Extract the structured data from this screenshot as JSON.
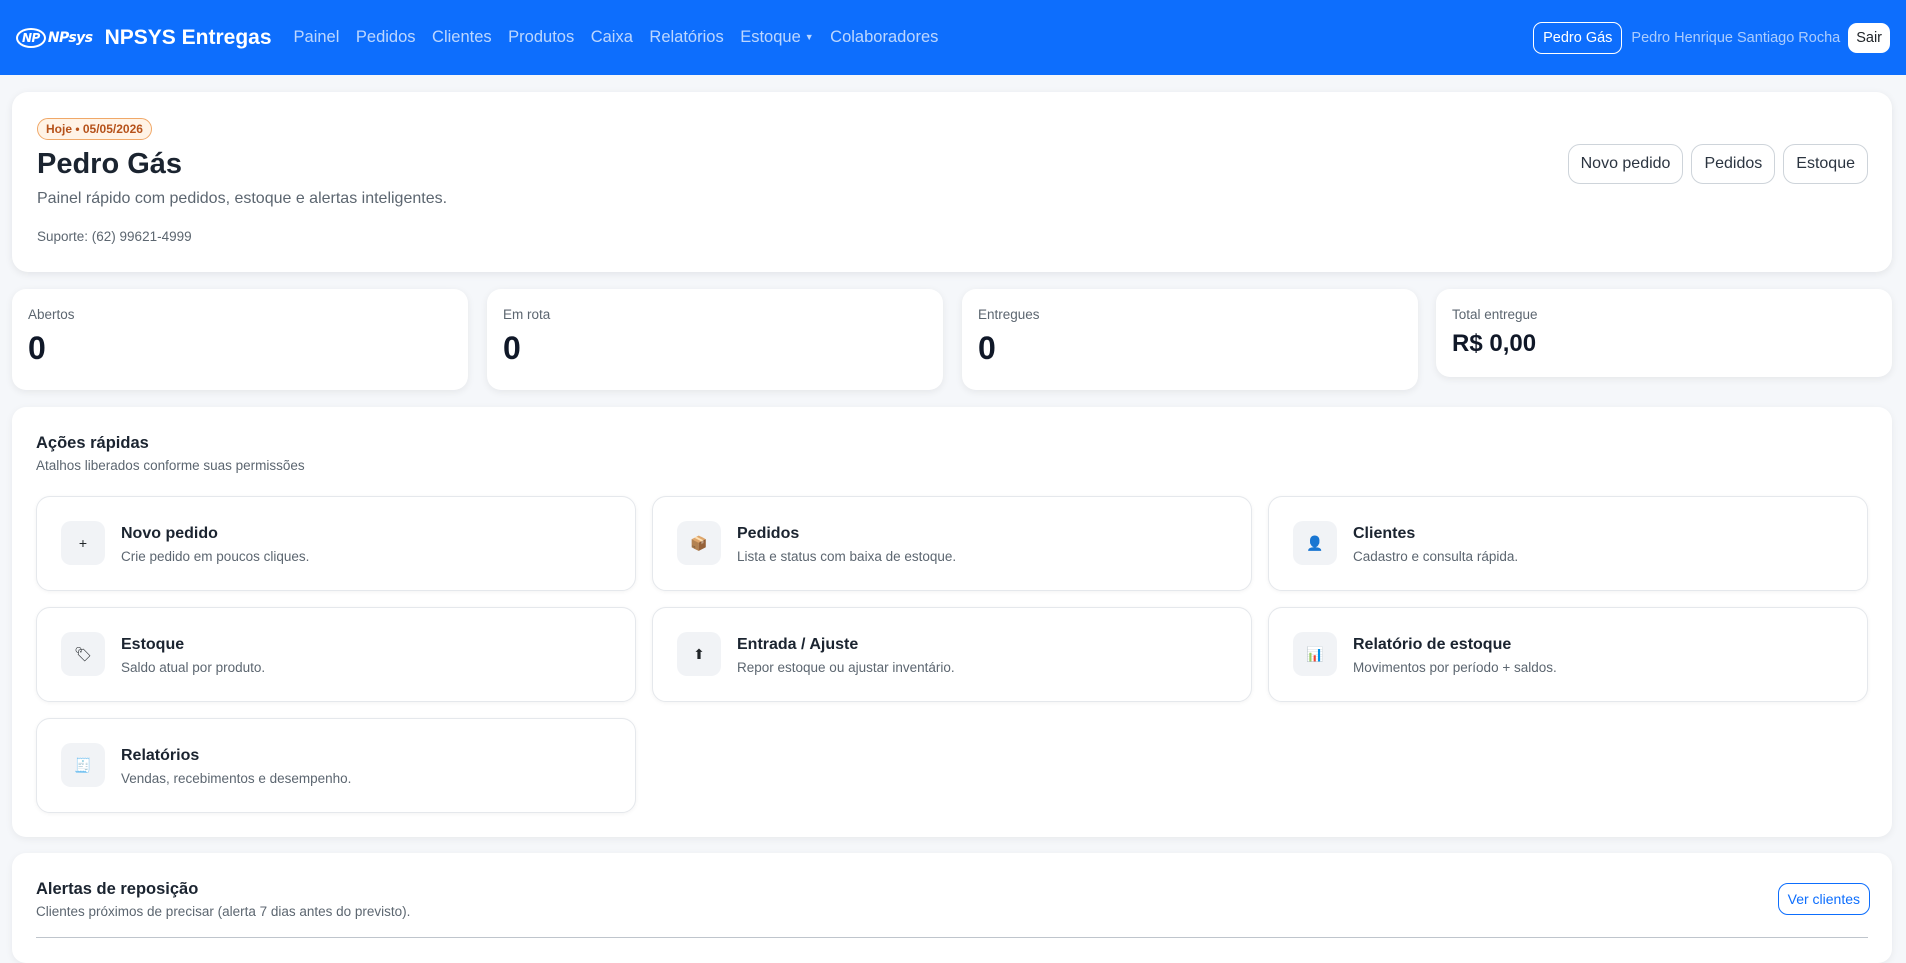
{
  "navbar": {
    "logo_text": "NPsys",
    "logo_mark": "NP",
    "brand": "NPSYS Entregas",
    "links": [
      "Painel",
      "Pedidos",
      "Clientes",
      "Produtos",
      "Caixa",
      "Relatórios",
      "Estoque",
      "Colaboradores"
    ],
    "company": "Pedro Gás",
    "user": "Pedro Henrique Santiago Rocha",
    "logout": "Sair"
  },
  "hero": {
    "date_badge": "Hoje • 05/05/2026",
    "title": "Pedro Gás",
    "subtitle": "Painel rápido com pedidos, estoque e alertas inteligentes.",
    "support": "Suporte: (62) 99621-4999",
    "actions": [
      "Novo pedido",
      "Pedidos",
      "Estoque"
    ]
  },
  "stats": [
    {
      "label": "Abertos",
      "value": "0"
    },
    {
      "label": "Em rota",
      "value": "0"
    },
    {
      "label": "Entregues",
      "value": "0"
    },
    {
      "label": "Total entregue",
      "value": "R$ 0,00"
    }
  ],
  "quick_actions": {
    "title": "Ações rápidas",
    "subtitle": "Atalhos liberados conforme suas permissões",
    "tiles": [
      {
        "icon": "plus-icon",
        "glyph": "+",
        "title": "Novo pedido",
        "desc": "Crie pedido em poucos cliques."
      },
      {
        "icon": "package-icon",
        "glyph": "📦",
        "title": "Pedidos",
        "desc": "Lista e status com baixa de estoque."
      },
      {
        "icon": "user-icon",
        "glyph": "👤",
        "title": "Clientes",
        "desc": "Cadastro e consulta rápida."
      },
      {
        "icon": "tag-icon",
        "glyph": "🏷",
        "title": "Estoque",
        "desc": "Saldo atual por produto."
      },
      {
        "icon": "up-arrow-icon",
        "glyph": "⬆",
        "title": "Entrada / Ajuste",
        "desc": "Repor estoque ou ajustar inventário."
      },
      {
        "icon": "bar-chart-icon",
        "glyph": "📊",
        "title": "Relatório de estoque",
        "desc": "Movimentos por período + saldos."
      },
      {
        "icon": "report-icon",
        "glyph": "🧾",
        "title": "Relatórios",
        "desc": "Vendas, recebimentos e desempenho."
      }
    ]
  },
  "alerts": {
    "title": "Alertas de reposição",
    "subtitle": "Clientes próximos de precisar (alerta 7 dias antes do previsto).",
    "button": "Ver clientes"
  },
  "colors": {
    "primary": "#0d6efd",
    "badge_bg": "#fff3e6",
    "badge_text": "#b6521a"
  }
}
